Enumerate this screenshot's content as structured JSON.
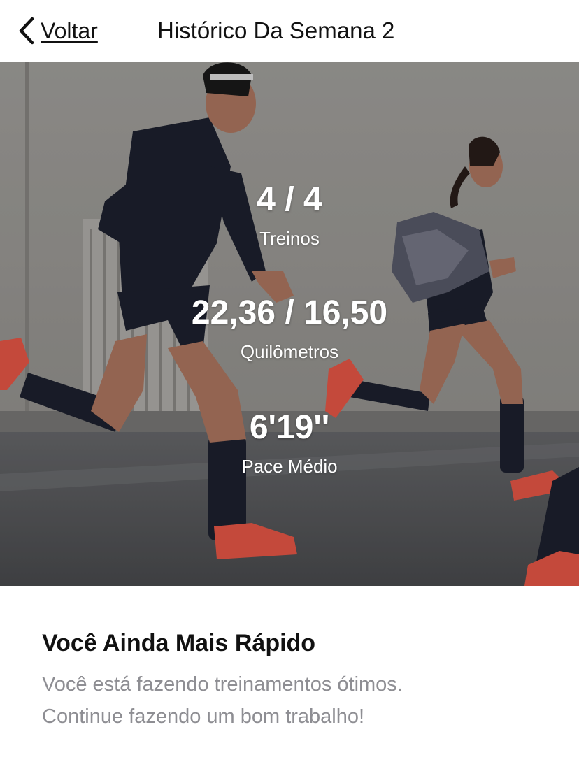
{
  "header": {
    "back_label": "Voltar",
    "title": "Histórico Da Semana 2"
  },
  "hero": {
    "image": "runners-photo",
    "stats": [
      {
        "value": "4 / 4",
        "label": "Treinos"
      },
      {
        "value": "22,36 / 16,50",
        "label": "Quilômetros"
      },
      {
        "value": "6'19''",
        "label": "Pace Médio"
      }
    ]
  },
  "content": {
    "title": "Você Ainda Mais Rápido",
    "body_lines": [
      "Você está fazendo treinamentos ótimos.",
      "Continue fazendo um bom trabalho!"
    ]
  },
  "colors": {
    "text_primary": "#111111",
    "text_secondary": "#8e8e93",
    "stat_text": "#ffffff",
    "shoe_accent": "#ef5a48"
  }
}
